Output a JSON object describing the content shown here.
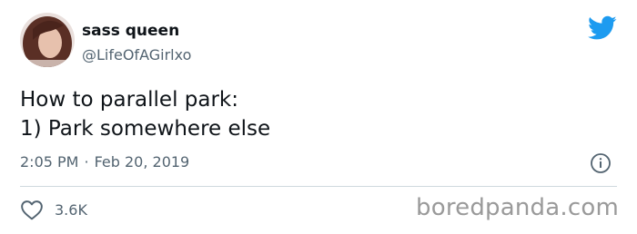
{
  "author": {
    "display_name": "sass queen",
    "handle": "@LifeOfAGirlxo"
  },
  "tweet": {
    "text": "How to parallel park:\n1) Park somewhere else",
    "time": "2:05 PM",
    "separator": "·",
    "date": "Feb 20, 2019"
  },
  "engagement": {
    "likes": "3.6K"
  },
  "icons": {
    "brand": "twitter-bird-icon",
    "info": "info-icon",
    "like": "heart-icon"
  },
  "colors": {
    "twitter_blue": "#1d9bf0",
    "secondary_text": "#536471",
    "divider": "#cfd9de"
  },
  "watermark": "boredpanda.com"
}
